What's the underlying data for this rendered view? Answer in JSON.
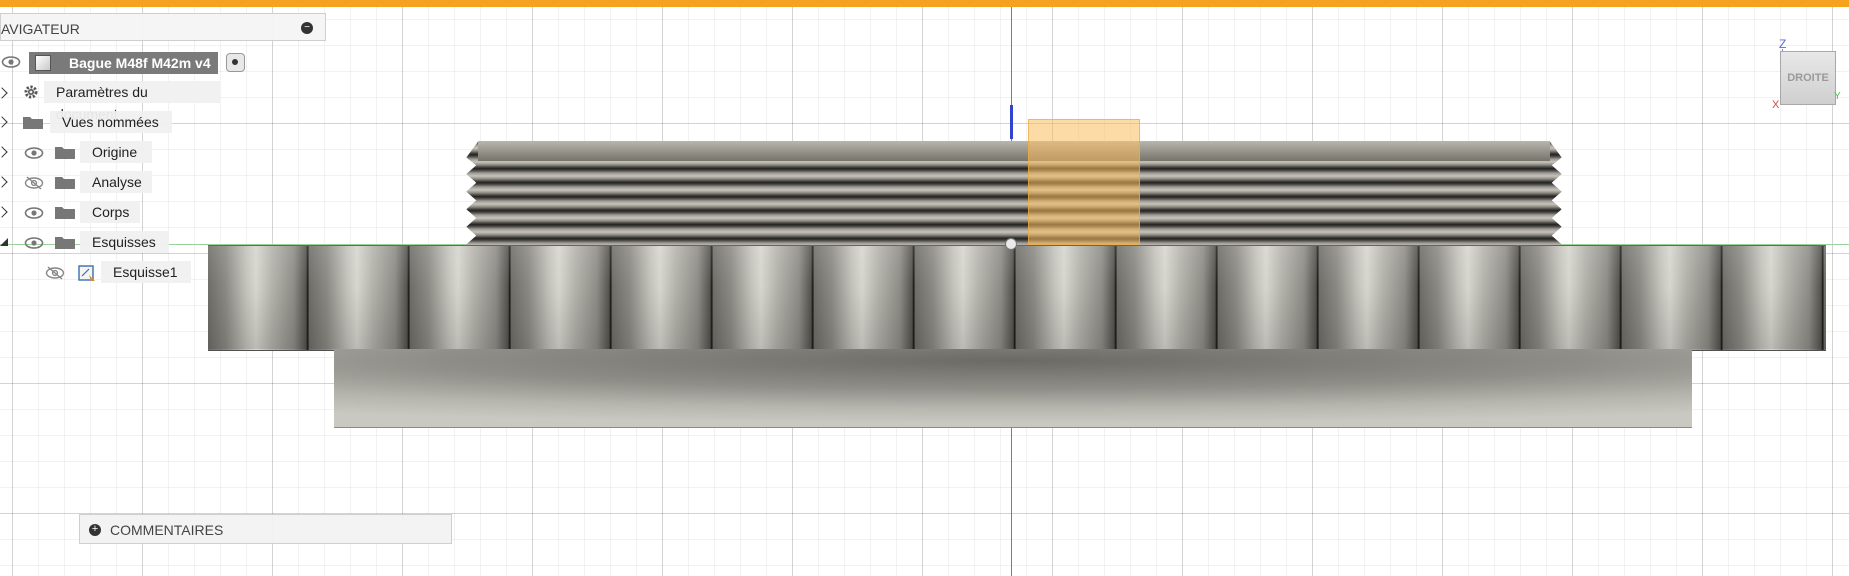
{
  "navigator": {
    "title": "AVIGATEUR",
    "collapse_symbol": "−",
    "root": {
      "label": "Bague M48f M42m v4"
    },
    "items": [
      {
        "label": "Paramètres du document",
        "icon": "gear-icon"
      },
      {
        "label": "Vues nommées",
        "icon": "folder-icon"
      },
      {
        "label": "Origine",
        "icon": "folder-icon",
        "visibility": "visible"
      },
      {
        "label": "Analyse",
        "icon": "folder-icon",
        "visibility": "hidden"
      },
      {
        "label": "Corps",
        "icon": "folder-icon",
        "visibility": "visible"
      },
      {
        "label": "Esquisses",
        "icon": "folder-icon",
        "visibility": "visible",
        "expanded": true
      },
      {
        "label": "Esquisse1",
        "icon": "sketch-icon",
        "visibility": "hidden"
      }
    ]
  },
  "viewcube": {
    "face": "DROITE",
    "z": "Z",
    "y": "Y",
    "x": "X"
  },
  "comments": {
    "label": "COMMENTAIRES",
    "symbol": "+"
  },
  "colors": {
    "accent_bar": "#f6a21e",
    "sketch_plane": "#fcbe5f",
    "z_axis": "#3344cc",
    "x_axis": "#dd4444",
    "y_axis": "#55bb55"
  }
}
